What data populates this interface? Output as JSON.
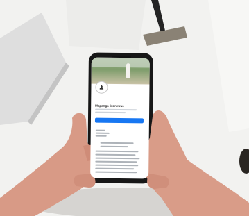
{
  "scene": {
    "background": "#f2f2f0",
    "laptop_color": "#dcdcdc",
    "phone_frame_color": "#171717",
    "skin_color": "#d89a86",
    "screen_bg": "#ffffff",
    "button_color": "#1877f2"
  },
  "phone_screen": {
    "avatar_icon": "person-icon",
    "page_name": "Mapanga Stonetras"
  }
}
